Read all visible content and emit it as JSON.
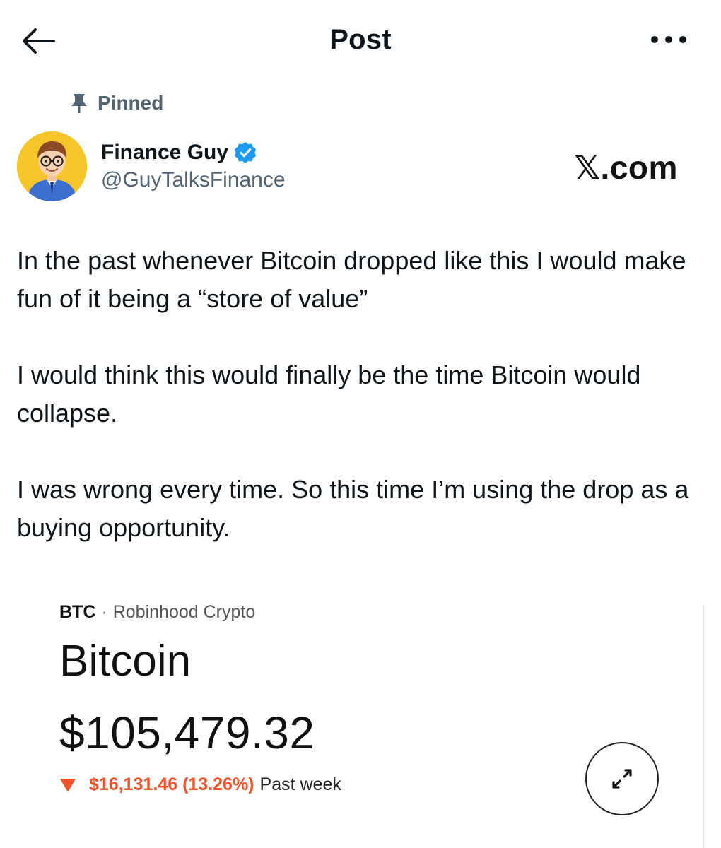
{
  "header": {
    "title": "Post",
    "back_icon": "arrow-left-icon",
    "more_icon": "more-horizontal-icon"
  },
  "pinned": {
    "label": "Pinned",
    "icon": "pin-icon"
  },
  "author": {
    "name": "Finance Guy",
    "handle": "@GuyTalksFinance",
    "verified": true,
    "verified_color": "#1d9bf0"
  },
  "watermark": "𝕏.com",
  "post": {
    "paragraphs": [
      "In the past whenever Bitcoin dropped like this I would make fun of it being a “store of value”",
      "I would think this would finally be the time Bitcoin would collapse.",
      "I was wrong every time. So this time I’m using the drop as a buying opportunity."
    ]
  },
  "card": {
    "ticker": "BTC",
    "separator": "·",
    "source": "Robinhood Crypto",
    "name": "Bitcoin",
    "price": "$105,479.32",
    "change_value": "$16,131.46 (13.26%)",
    "change_period": "Past week",
    "change_direction": "down",
    "change_color": "#f0532a",
    "expand_icon": "expand-arrows-icon"
  }
}
